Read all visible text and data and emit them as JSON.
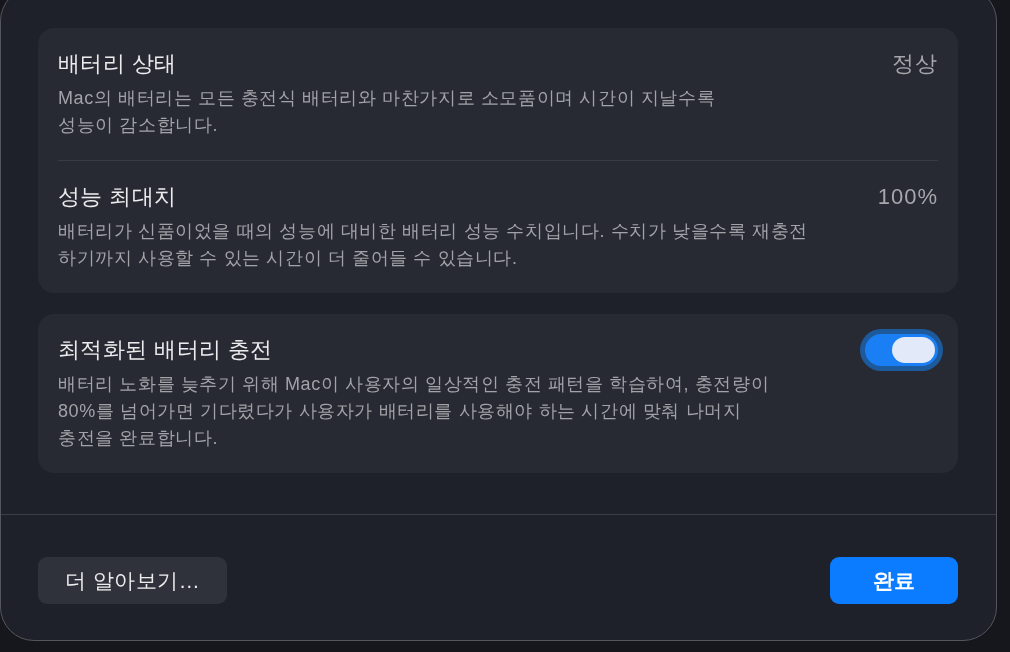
{
  "sections": [
    {
      "rows": [
        {
          "kind": "value",
          "title": "배터리 상태",
          "value": "정상",
          "description": "Mac의 배터리는 모든 충전식 배터리와 마찬가지로 소모품이며 시간이 지날수록\n성능이 감소합니다."
        },
        {
          "kind": "value",
          "title": "성능 최대치",
          "value": "100%",
          "description": "배터리가 신품이었을 때의 성능에 대비한 배터리 성능 수치입니다. 수치가 낮을수록 재충전\n하기까지 사용할 수 있는 시간이 더 줄어들 수 있습니다."
        }
      ]
    },
    {
      "rows": [
        {
          "kind": "toggle",
          "title": "최적화된 배터리 충전",
          "on": true,
          "focused": true,
          "description": "배터리 노화를 늦추기 위해 Mac이 사용자의 일상적인 충전 패턴을 학습하여, 충전량이\n80%를 넘어가면 기다렸다가 사용자가 배터리를 사용해야 하는 시간에 맞춰 나머지\n충전을 완료합니다."
        }
      ]
    }
  ],
  "buttons": [
    {
      "label": "더 알아보기…",
      "primary": false
    },
    {
      "label": "완료",
      "primary": true
    }
  ]
}
